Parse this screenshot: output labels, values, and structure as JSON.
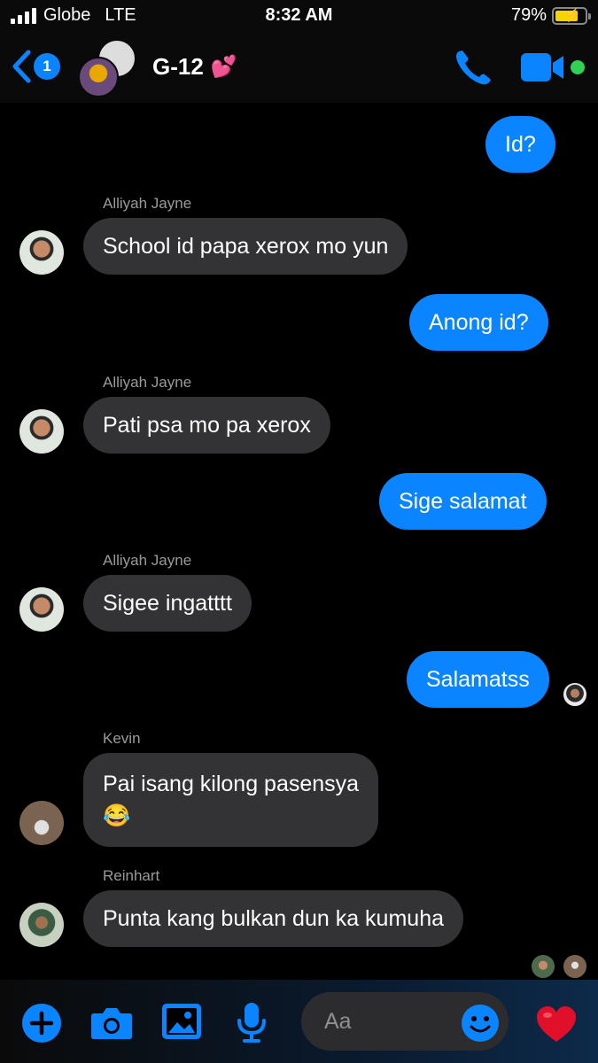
{
  "status_bar": {
    "carrier": "Globe",
    "network": "LTE",
    "time": "8:32 AM",
    "battery": "79%",
    "battery_level": 0.79
  },
  "header": {
    "back_count": "1",
    "title": "G-12",
    "title_emoji": "💕",
    "online": true,
    "icons": [
      "chevron-left-icon",
      "phone-icon",
      "video-camera-icon"
    ]
  },
  "messages": [
    {
      "direction": "out",
      "text": "Id?"
    },
    {
      "direction": "in",
      "sender": "Alliyah Jayne",
      "text": "School id papa xerox mo yun"
    },
    {
      "direction": "out",
      "text": "Anong id?"
    },
    {
      "direction": "in",
      "sender": "Alliyah Jayne",
      "text": "Pati psa mo pa xerox"
    },
    {
      "direction": "out",
      "text": "Sige salamat"
    },
    {
      "direction": "in",
      "sender": "Alliyah Jayne",
      "text": "Sigee ingatttt"
    },
    {
      "direction": "out",
      "text": "Salamatss"
    },
    {
      "direction": "in",
      "sender": "Kevin",
      "text": "Pai isang kilong pasensya",
      "text2": "😂"
    },
    {
      "direction": "in",
      "sender": "Reinhart",
      "text": "Punta kang bulkan dun ka kumuha"
    }
  ],
  "composer": {
    "placeholder": "Aa",
    "icons": [
      "plus-icon",
      "camera-icon",
      "image-icon",
      "microphone-icon",
      "emoji-icon",
      "heart-icon"
    ]
  },
  "colors": {
    "accent": "#0a84ff",
    "incoming_bubble": "#333335",
    "background": "#000000",
    "online": "#31d158",
    "heart": "#e0102a"
  }
}
